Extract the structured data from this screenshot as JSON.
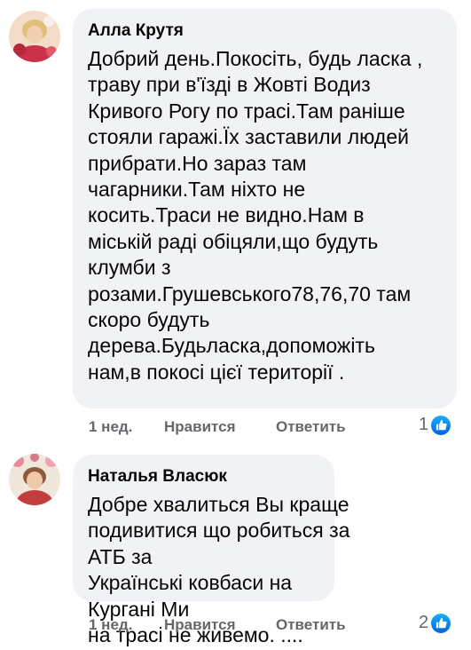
{
  "comments": [
    {
      "author": "Алла Крутя",
      "text": "Добрий день.Покосіть, будь ласка ,\nтраву при в'їзді в Жовті Водиз\nКривого Рогу по  трасі.Там раніше\nстояли гаражі.Їх заставили людей\nприбрати.Но зараз там\nчагарники.Там ніхто не\nкосить.Траси не видно.Нам в\nміській раді обіцяли,що будуть\nклумби з\nрозами.Грушевського78,76,70 там\nскоро будуть\nдерева.Будьласка,допоможіть\nнам,в покосі цієї території .",
      "time": "1 нед.",
      "like_label": "Нравится",
      "reply_label": "Ответить",
      "reaction_count": "1"
    },
    {
      "author": "Наталья Власюк",
      "text": "Добре хвалиться Вы краще\nподивитися що робиться за АТБ за\nУкраїнські ковбаси на Кургані Ми\nна трасі не живемо. ....",
      "time": "1 нед.",
      "like_label": "Нравится",
      "reply_label": "Ответить",
      "reaction_count": "2"
    }
  ],
  "colors": {
    "bubble": "#f0f2f5",
    "meta_text": "#65676b",
    "like_blue": "#1877f2"
  },
  "icons": [
    "avatar-photo",
    "like-reaction-icon"
  ]
}
